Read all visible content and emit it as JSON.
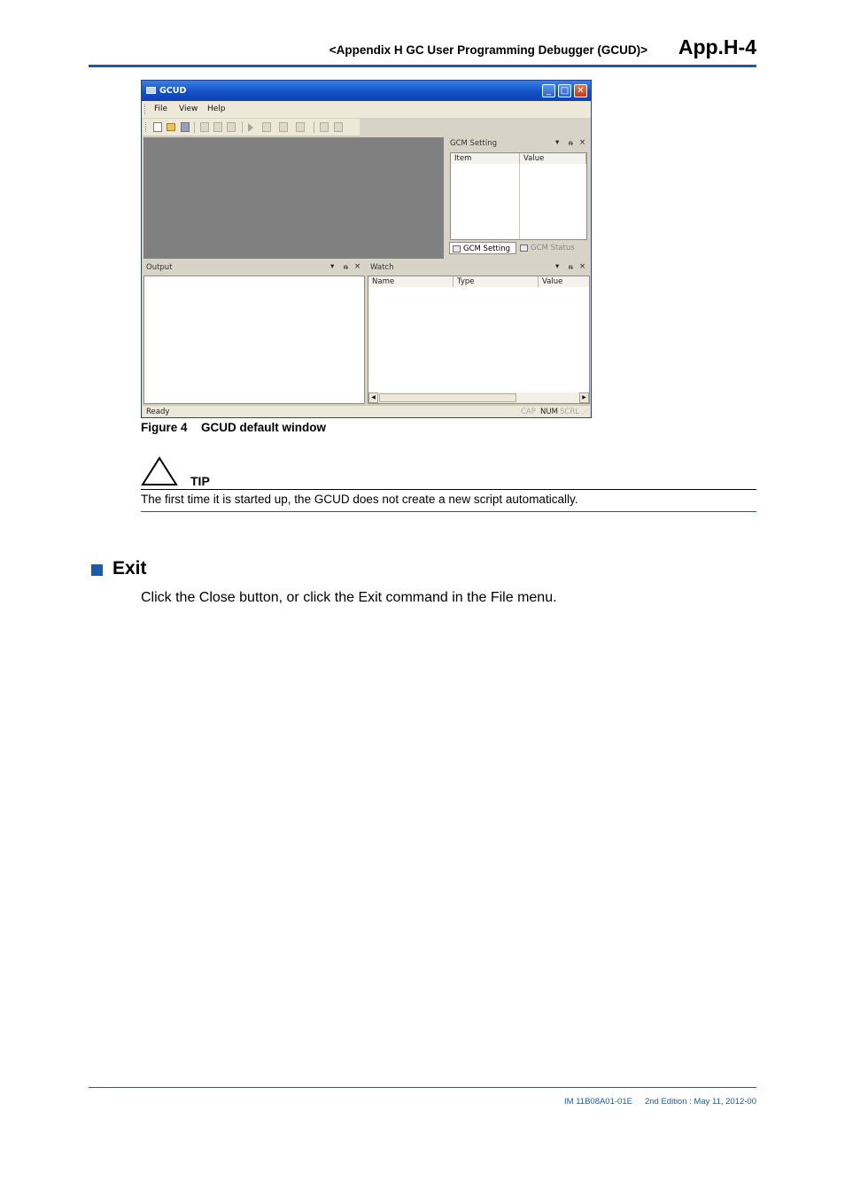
{
  "header": {
    "title": "<Appendix H  GC User Programming Debugger (GCUD)>",
    "page": "App.H-4"
  },
  "screenshot": {
    "app_title": "GCUD",
    "window_buttons": {
      "minimize": "_",
      "maximize": "□",
      "close": "✕"
    },
    "menu": [
      "File",
      "View",
      "Help"
    ],
    "gcm_pane": {
      "title": "GCM Setting",
      "controls": [
        "▾",
        "ᵰ",
        "×"
      ],
      "columns": [
        "Item",
        "Value"
      ],
      "tabs": [
        "GCM Setting",
        "GCM Status"
      ]
    },
    "output_pane": {
      "title": "Output",
      "controls": [
        "▾",
        "ᵰ",
        "×"
      ]
    },
    "watch_pane": {
      "title": "Watch",
      "controls": [
        "▾",
        "ᵰ",
        "×"
      ],
      "columns": [
        "Name",
        "Type",
        "Value"
      ]
    },
    "status_bar": {
      "text": "Ready",
      "indicators": [
        "CAP",
        "NUM",
        "SCRL"
      ]
    }
  },
  "figure_caption": {
    "number": "Figure 4",
    "text": "GCUD default window"
  },
  "tip": {
    "label": "TIP",
    "text": "The first time it is started up, the GCUD does not create a new script automatically."
  },
  "section": {
    "title": "Exit",
    "body": "Click the Close button, or click the Exit command in the File menu."
  },
  "footer": {
    "doc_id": "IM 11B08A01-01E",
    "edition": "2nd Edition : May 11, 2012-00"
  }
}
